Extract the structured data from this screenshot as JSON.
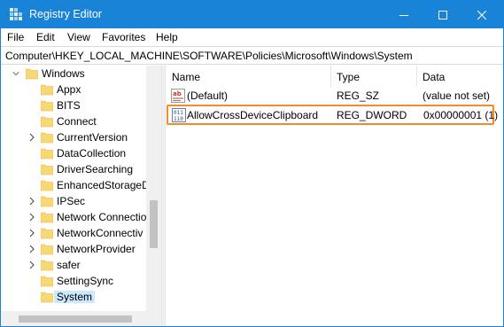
{
  "window": {
    "title": "Registry Editor",
    "controls": {
      "minimize_glyph": "─",
      "close_glyph": "✕"
    },
    "accent_color": "#1883d7",
    "highlight_color": "#f28c28"
  },
  "menu": [
    "File",
    "Edit",
    "View",
    "Favorites",
    "Help"
  ],
  "address": "Computer\\HKEY_LOCAL_MACHINE\\SOFTWARE\\Policies\\Microsoft\\Windows\\System",
  "tree": {
    "parent": "Windows",
    "children": [
      {
        "label": "Appx",
        "expandable": false
      },
      {
        "label": "BITS",
        "expandable": false
      },
      {
        "label": "Connect",
        "expandable": false
      },
      {
        "label": "CurrentVersion",
        "expandable": true
      },
      {
        "label": "DataCollection",
        "expandable": false
      },
      {
        "label": "DriverSearching",
        "expandable": false
      },
      {
        "label": "EnhancedStorageD",
        "expandable": false
      },
      {
        "label": "IPSec",
        "expandable": true
      },
      {
        "label": "Network Connectio",
        "expandable": true
      },
      {
        "label": "NetworkConnectiv",
        "expandable": true
      },
      {
        "label": "NetworkProvider",
        "expandable": true
      },
      {
        "label": "safer",
        "expandable": true
      },
      {
        "label": "SettingSync",
        "expandable": false
      },
      {
        "label": "System",
        "expandable": false,
        "selected": true
      }
    ]
  },
  "list": {
    "columns": [
      "Name",
      "Type",
      "Data"
    ],
    "rows": [
      {
        "icon": "string-value-icon",
        "name": "(Default)",
        "type": "REG_SZ",
        "data": "(value not set)",
        "highlighted": false
      },
      {
        "icon": "binary-value-icon",
        "name": "AllowCrossDeviceClipboard",
        "type": "REG_DWORD",
        "data": "0x00000001 (1)",
        "highlighted": true
      }
    ]
  }
}
